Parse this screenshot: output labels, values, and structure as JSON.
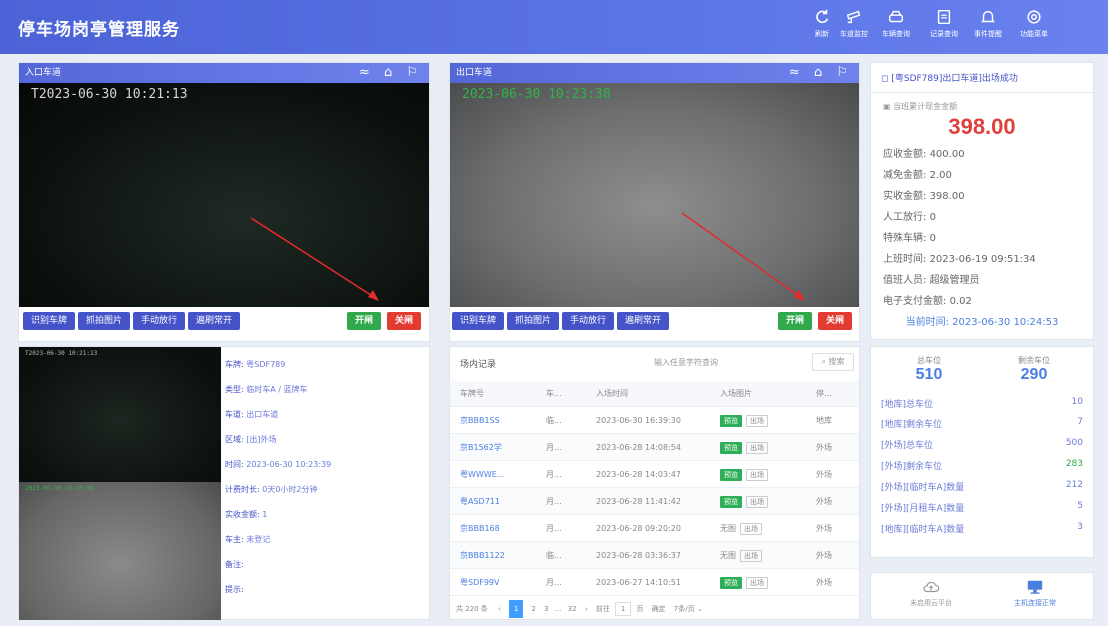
{
  "header": {
    "title": "停车场岗亭管理服务",
    "buttons": [
      {
        "label": "刷新",
        "icon": "refresh-icon"
      },
      {
        "label": "车道监控",
        "icon": "camera-icon"
      },
      {
        "label": "车辆查询",
        "icon": "car-icon"
      },
      {
        "label": "记录查询",
        "icon": "record-icon"
      },
      {
        "label": "事件提醒",
        "icon": "bell-icon"
      },
      {
        "label": "功能菜单",
        "icon": "gear-icon"
      }
    ]
  },
  "entry_lane": {
    "title": "入口车道",
    "timestamp": "T2023-06-30 10:21:13",
    "buttons": [
      "识别车牌",
      "抓拍图片",
      "手动放行",
      "遍刷常开"
    ],
    "open_label": "开闸",
    "close_label": "关闸"
  },
  "exit_lane": {
    "title": "出口车道",
    "timestamp": "2023-06-30 10:23:38",
    "buttons": [
      "识别车牌",
      "抓拍图片",
      "手动放行",
      "遍刷常开"
    ],
    "open_label": "开闸",
    "close_label": "关闸"
  },
  "fee_panel": {
    "message": "[粤SDF789]出口车道]出场成功",
    "total_label": "当班累计现金金额",
    "total_amount": "398.00",
    "rows": [
      {
        "label": "应收金额:",
        "value": "400.00"
      },
      {
        "label": "减免金额:",
        "value": "2.00"
      },
      {
        "label": "实收金额:",
        "value": "398.00"
      },
      {
        "label": "人工放行:",
        "value": "0"
      },
      {
        "label": "特殊车辆:",
        "value": "0"
      },
      {
        "label": "上班时间:",
        "value": "2023-06-19 09:51:34"
      },
      {
        "label": "值班人员:",
        "value": "超级管理员"
      },
      {
        "label": "电子支付金额:",
        "value": "0.02"
      }
    ],
    "current_time_label": "当前时间:",
    "current_time": "2023-06-30 10:24:53"
  },
  "vehicle_info": {
    "snap_time_top": "T2023-06-30 10:21:13",
    "snap_time_bottom": "2023-06-30 10:23:38",
    "rows": [
      {
        "label": "车牌:",
        "value": "粤SDF789"
      },
      {
        "label": "类型:",
        "value": "临时车A / 蓝牌车"
      },
      {
        "label": "车道:",
        "value": "出口车道"
      },
      {
        "label": "区域:",
        "value": "[出]外场"
      },
      {
        "label": "时间:",
        "value": "2023-06-30 10:23:39"
      },
      {
        "label": "计费时长:",
        "value": "0天0小时2分钟"
      },
      {
        "label": "实收金额:",
        "value": "1"
      },
      {
        "label": "车主:",
        "value": "未登记"
      },
      {
        "label": "备注:",
        "value": ""
      },
      {
        "label": "提示:",
        "value": ""
      }
    ]
  },
  "records": {
    "title": "场内记录",
    "search_placeholder": "输入任意字符查询",
    "search_label": "搜索",
    "columns": [
      "车牌号",
      "车...",
      "入场时间",
      "入场图片",
      "停..."
    ],
    "rows": [
      {
        "plate": "京BBB1SS",
        "type": "临...",
        "time": "2023-06-30 16:39:30",
        "img": "预览",
        "area": "地库"
      },
      {
        "plate": "京B1562学",
        "type": "月...",
        "time": "2023-06-28 14:08:54",
        "img": "预览",
        "area": "外场"
      },
      {
        "plate": "粤WWWE...",
        "type": "月...",
        "time": "2023-06-28 14:03:47",
        "img": "预览",
        "area": "外场"
      },
      {
        "plate": "粤ASD711",
        "type": "月...",
        "time": "2023-06-28 11:41:42",
        "img": "预览",
        "area": "外场"
      },
      {
        "plate": "京BBB168",
        "type": "月...",
        "time": "2023-06-28 09:20:20",
        "img": "无图",
        "area": "外场"
      },
      {
        "plate": "京BBB1122",
        "type": "临...",
        "time": "2023-06-28 03:36:37",
        "img": "无图",
        "area": "外场"
      },
      {
        "plate": "粤SDF99V",
        "type": "月...",
        "time": "2023-06-27 14:10:51",
        "img": "预览",
        "area": "外场"
      }
    ],
    "out_label": "出场",
    "pagination": {
      "total": "共 220 条",
      "pages": [
        "1",
        "2",
        "3",
        "...",
        "32"
      ],
      "goto_label": "前往",
      "goto_value": "1",
      "page_unit": "页",
      "confirm_label": "确定",
      "page_size": "7条/页"
    }
  },
  "spaces": {
    "total_label": "总车位",
    "total_value": "510",
    "remain_label": "剩余车位",
    "remain_value": "290",
    "rows": [
      {
        "label": "[地库]总车位",
        "value": "10"
      },
      {
        "label": "[地库]剩余车位",
        "value": "7"
      },
      {
        "label": "[外场]总车位",
        "value": "500"
      },
      {
        "label": "[外场]剩余车位",
        "value": "283"
      },
      {
        "label": "[外场][临时车A]数量",
        "value": "212"
      },
      {
        "label": "[外场][月租车A]数量",
        "value": "5"
      },
      {
        "label": "[地库][临时车A]数量",
        "value": "3"
      }
    ]
  },
  "footer_panel": {
    "cloud_label": "未启用云平台",
    "host_label": "主机连接正常"
  }
}
